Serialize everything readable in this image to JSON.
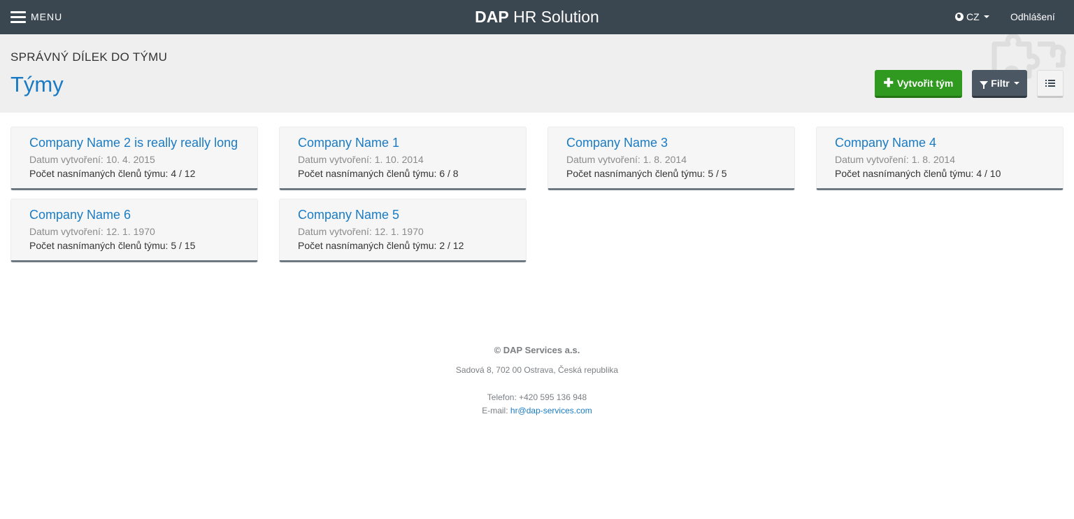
{
  "navbar": {
    "menu_label": "MENU",
    "brand_bold": "DAP",
    "brand_rest": " HR Solution",
    "language": "CZ",
    "logout": "Odhlášení",
    "background": "#3a4650"
  },
  "header": {
    "subtitle": "SPRÁVNÝ DÍLEK DO TÝMU",
    "title": "Týmy",
    "create_button": "Vytvořit tým",
    "filter_button": "Filtr",
    "accent_color": "#1a7bc4",
    "create_color": "#2f9a1f"
  },
  "teams": [
    {
      "name": "Company Name 2 is really really long",
      "date": "Datum vytvoření: 10. 4. 2015",
      "members": "Počet nasnímaných členů týmu: 4 / 12"
    },
    {
      "name": "Company Name 1",
      "date": "Datum vytvoření: 1. 10. 2014",
      "members": "Počet nasnímaných členů týmu: 6 / 8"
    },
    {
      "name": "Company Name 3",
      "date": "Datum vytvoření: 1. 8. 2014",
      "members": "Počet nasnímaných členů týmu: 5 / 5"
    },
    {
      "name": "Company Name 4",
      "date": "Datum vytvoření: 1. 8. 2014",
      "members": "Počet nasnímaných členů týmu: 4 / 10"
    },
    {
      "name": "Company Name 6",
      "date": "Datum vytvoření: 12. 1. 1970",
      "members": "Počet nasnímaných členů týmu: 5 / 15"
    },
    {
      "name": "Company Name 5",
      "date": "Datum vytvoření: 12. 1. 1970",
      "members": "Počet nasnímaných členů týmu: 2 / 12"
    }
  ],
  "footer": {
    "company": "© DAP Services a.s.",
    "address": "Sadová 8, 702 00 Ostrava, Česká republika",
    "phone": "Telefon: +420 595 136 948",
    "email_label": "E-mail: ",
    "email": "hr@dap-services.com"
  }
}
